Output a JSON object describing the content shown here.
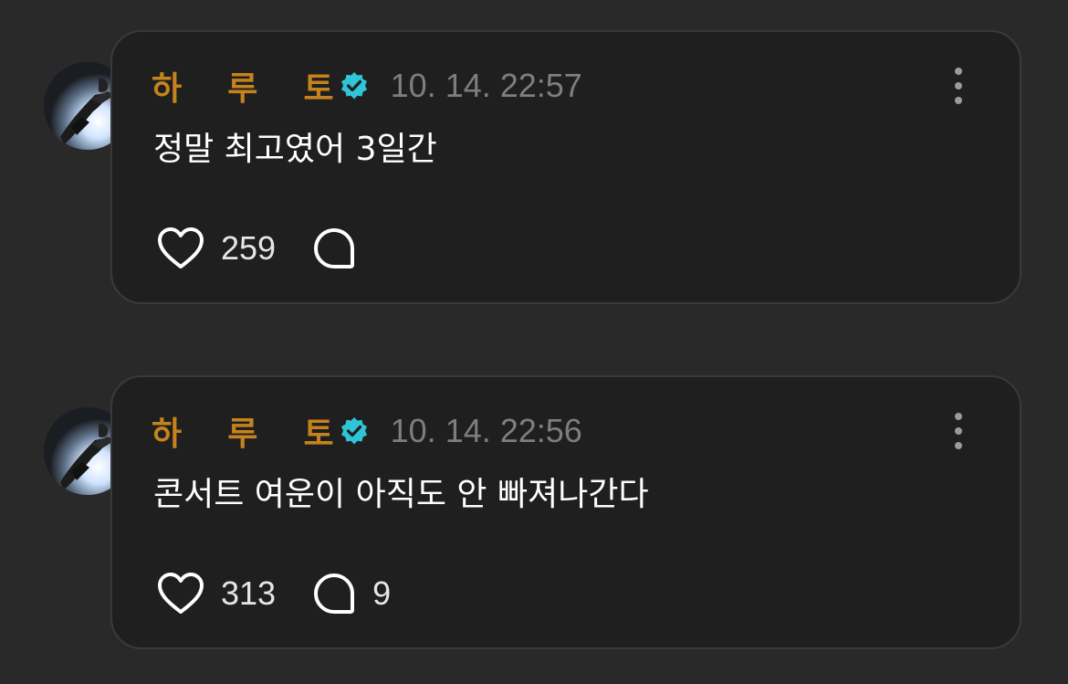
{
  "posts": [
    {
      "author": "하    루    토",
      "verified": true,
      "timestamp": "10. 14. 22:57",
      "text": "정말 최고였어 3일간",
      "like_count": "259",
      "comment_count": ""
    },
    {
      "author": "하    루    토",
      "verified": true,
      "timestamp": "10. 14. 22:56",
      "text": "콘서트 여운이 아직도 안 빠져나간다",
      "like_count": "313",
      "comment_count": "9"
    }
  ],
  "colors": {
    "background": "#292929",
    "card": "#1f1f1f",
    "author": "#c5831d",
    "verified_badge": "#2fc4d6",
    "timestamp": "#7e7e7e",
    "text": "#ffffff"
  },
  "icons": {
    "verified": "verified-badge-icon",
    "more": "more-vertical-icon",
    "like": "heart-icon",
    "comment": "comment-bubble-icon"
  }
}
